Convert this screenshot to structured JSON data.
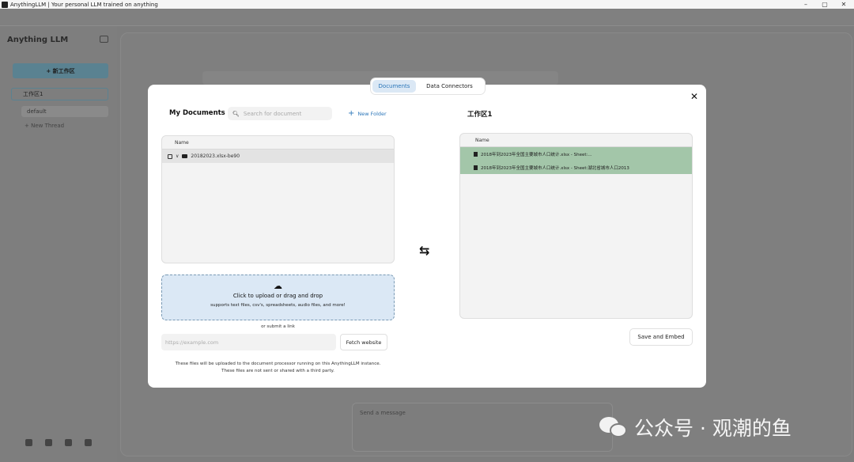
{
  "window": {
    "title": "AnythingLLM | Your personal LLM trained on anything",
    "controls": [
      "–",
      "▢",
      "✕"
    ]
  },
  "background": {
    "logo": "Anything LLM",
    "new_workspace_label": "+ 新工作区",
    "workspace_name": "工作区1",
    "thread_default": "default",
    "new_thread_label": "+ New Thread",
    "chat_placeholder": "Send a message"
  },
  "modal": {
    "tabs": [
      {
        "label": "Documents",
        "active": true
      },
      {
        "label": "Data Connectors",
        "active": false
      }
    ],
    "close_icon": "✕",
    "left": {
      "title": "My Documents",
      "search_placeholder": "Search for document",
      "new_folder_label": "New Folder",
      "table_header": "Name",
      "folders": [
        {
          "name": "20182023.xlsx-be90"
        }
      ],
      "upload": {
        "title": "Click to upload or drag and drop",
        "subtitle": "supports text files, csv's, spreadsheets, audio files, and more!"
      },
      "submit_link_label": "or submit a link",
      "url_placeholder": "https://example.com",
      "fetch_button": "Fetch website",
      "footer_note_line1": "These files will be uploaded to the document processor running on this AnythingLLM instance.",
      "footer_note_line2": "These files are not sent or shared with a third party."
    },
    "right": {
      "title": "工作区1",
      "table_header": "Name",
      "files": [
        {
          "name": "2018年到2023年全国主要城市人口统计.xlsx - Sheet:..."
        },
        {
          "name": "2018年到2023年全国主要城市人口统计.xlsx - Sheet:湖北省城市人口2013"
        }
      ],
      "save_button": "Save and Embed"
    }
  },
  "watermark": {
    "text": "公众号 · 观潮的鱼"
  },
  "colors": {
    "accent": "#2b76b9",
    "tab_active_bg": "#dbe8f5",
    "embedded_row_bg": "#a3c6a9",
    "overlay": "#7d7d7d"
  }
}
